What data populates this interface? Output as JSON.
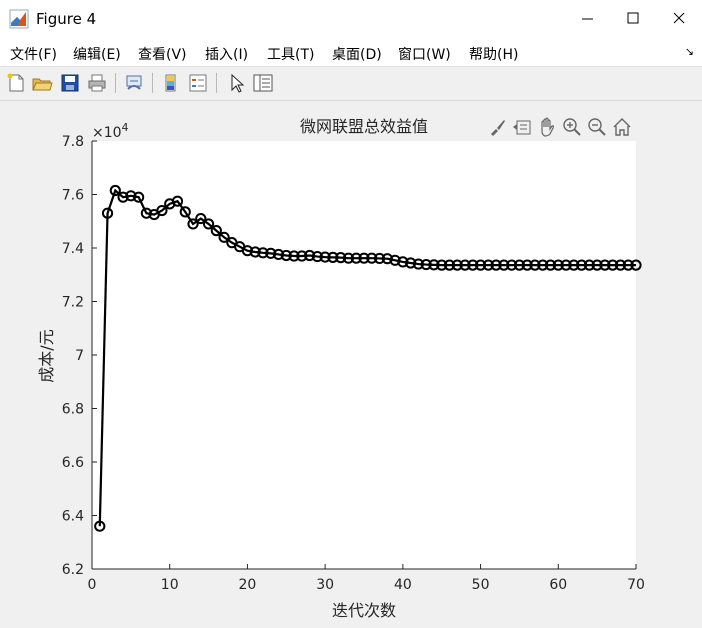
{
  "window": {
    "title": "Figure 4"
  },
  "menu": [
    "文件(F)",
    "编辑(E)",
    "查看(V)",
    "插入(I)",
    "工具(T)",
    "桌面(D)",
    "窗口(W)",
    "帮助(H)"
  ],
  "toolbar_icons": [
    "new-figure-icon",
    "open-file-icon",
    "save-icon",
    "print-icon",
    "link-plot-icon",
    "colorbar-icon",
    "legend-icon",
    "edit-plot-icon",
    "property-inspector-icon"
  ],
  "axes_toolbar_icons": [
    "brush-icon",
    "data-tips-icon",
    "pan-icon",
    "zoom-in-icon",
    "zoom-out-icon",
    "home-icon"
  ],
  "chart_data": {
    "type": "line",
    "title": "微网联盟总效益值",
    "xlabel": "迭代次数",
    "ylabel": "成本/元",
    "exponent_label": "×10",
    "exponent_power": "4",
    "xlim": [
      0,
      70
    ],
    "ylim": [
      62000,
      78000
    ],
    "xticks": [
      "0",
      "10",
      "20",
      "30",
      "40",
      "50",
      "60",
      "70"
    ],
    "yticks": [
      "6.2",
      "6.4",
      "6.6",
      "6.8",
      "7",
      "7.2",
      "7.4",
      "7.6",
      "7.8"
    ],
    "x": [
      1,
      2,
      3,
      4,
      5,
      6,
      7,
      8,
      9,
      10,
      11,
      12,
      13,
      14,
      15,
      16,
      17,
      18,
      19,
      20,
      21,
      22,
      23,
      24,
      25,
      26,
      27,
      28,
      29,
      30,
      31,
      32,
      33,
      34,
      35,
      36,
      37,
      38,
      39,
      40,
      41,
      42,
      43,
      44,
      45,
      46,
      47,
      48,
      49,
      50,
      51,
      52,
      53,
      54,
      55,
      56,
      57,
      58,
      59,
      60,
      61,
      62,
      63,
      64,
      65,
      66,
      67,
      68,
      69,
      70
    ],
    "values": [
      63600,
      75300,
      76150,
      75900,
      75950,
      75900,
      75300,
      75250,
      75400,
      75650,
      75750,
      75350,
      74900,
      75100,
      74900,
      74650,
      74400,
      74200,
      74050,
      73900,
      73850,
      73820,
      73800,
      73760,
      73720,
      73700,
      73700,
      73720,
      73680,
      73660,
      73650,
      73640,
      73620,
      73620,
      73620,
      73620,
      73610,
      73600,
      73540,
      73480,
      73440,
      73400,
      73380,
      73370,
      73360,
      73360,
      73360,
      73360,
      73360,
      73360,
      73360,
      73360,
      73360,
      73360,
      73360,
      73360,
      73360,
      73360,
      73360,
      73360,
      73360,
      73360,
      73360,
      73360,
      73360,
      73360,
      73360,
      73360,
      73360,
      73360
    ],
    "marker": "o",
    "line_color": "#000000",
    "grid": false
  }
}
